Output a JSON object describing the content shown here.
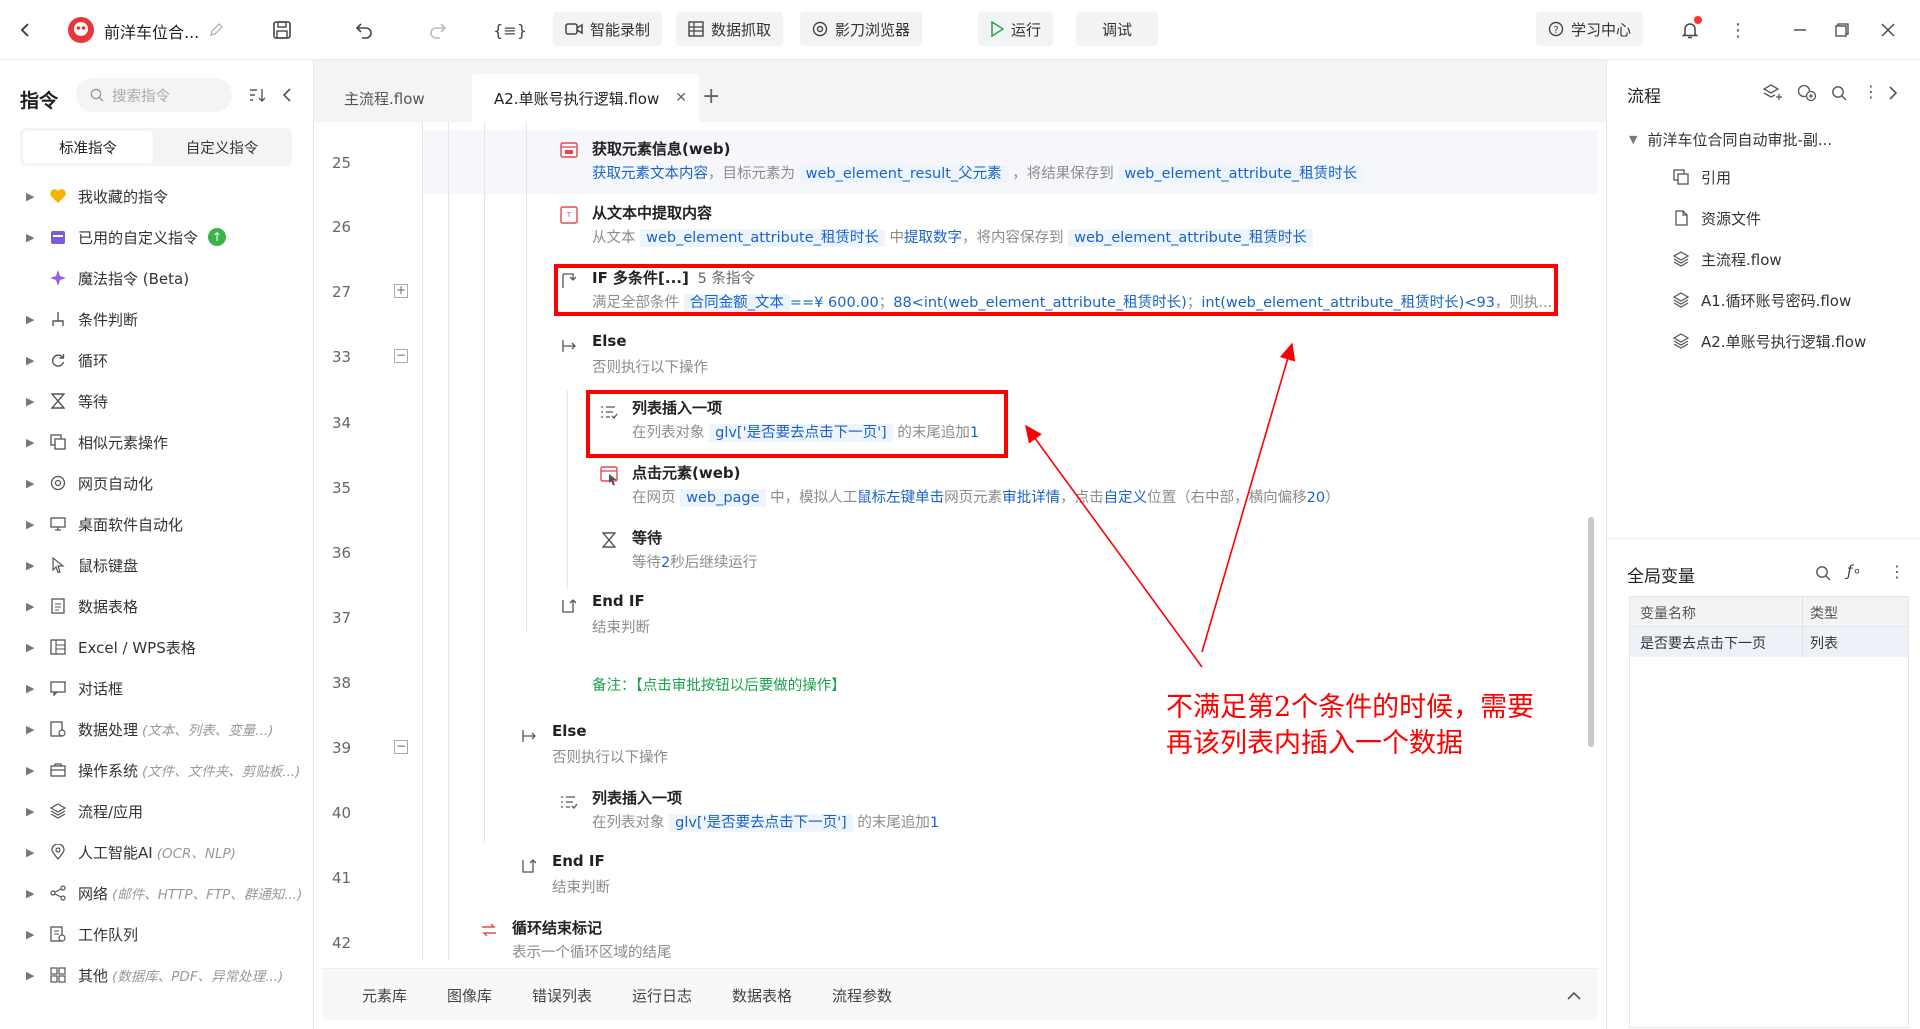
{
  "topbar": {
    "project_name": "前洋车位合...",
    "buttons": {
      "smart_record": "智能录制",
      "data_grab": "数据抓取",
      "browser": "影刀浏览器",
      "run": "运行",
      "debug": "调试",
      "learn": "学习中心"
    }
  },
  "left": {
    "title": "指令",
    "search_placeholder": "搜索指令",
    "tabs": {
      "standard": "标准指令",
      "custom": "自定义指令"
    },
    "items": [
      {
        "label": "我收藏的指令",
        "hint": ""
      },
      {
        "label": "已用的自定义指令",
        "hint": ""
      },
      {
        "label": "魔法指令 (Beta)",
        "hint": ""
      },
      {
        "label": "条件判断",
        "hint": ""
      },
      {
        "label": "循环",
        "hint": ""
      },
      {
        "label": "等待",
        "hint": ""
      },
      {
        "label": "相似元素操作",
        "hint": ""
      },
      {
        "label": "网页自动化",
        "hint": ""
      },
      {
        "label": "桌面软件自动化",
        "hint": ""
      },
      {
        "label": "鼠标键盘",
        "hint": ""
      },
      {
        "label": "数据表格",
        "hint": ""
      },
      {
        "label": "Excel / WPS表格",
        "hint": ""
      },
      {
        "label": "对话框",
        "hint": ""
      },
      {
        "label": "数据处理",
        "hint": "(文本、列表、变量...)"
      },
      {
        "label": "操作系统",
        "hint": "(文件、文件夹、剪贴板...)"
      },
      {
        "label": "流程/应用",
        "hint": ""
      },
      {
        "label": "人工智能AI",
        "hint": "(OCR、NLP)"
      },
      {
        "label": "网络",
        "hint": "(邮件、HTTP、FTP、群通知...)"
      },
      {
        "label": "工作队列",
        "hint": ""
      },
      {
        "label": "其他",
        "hint": "(数据库、PDF、异常处理...)"
      }
    ]
  },
  "tabs": [
    "主流程.flow",
    "A2.单账号执行逻辑.flow"
  ],
  "editor": {
    "rows": [
      {
        "num": "25",
        "title": "获取元素信息(web)",
        "desc": {
          "a": "获取元素文本内容",
          "b": "，目标元素为",
          "c": "web_element_result_父元素",
          "d": "，将结果保存到",
          "e": "web_element_attribute_租赁时长"
        }
      },
      {
        "num": "26",
        "title": "从文本中提取内容",
        "desc": {
          "a": "从文本",
          "b": "web_element_attribute_租赁时长",
          "c": "中",
          "d": "提取数字",
          "e": "，将内容保存到",
          "f": "web_element_attribute_租赁时长"
        }
      },
      {
        "num": "27",
        "title": "IF 多条件[...]",
        "count": "5 条指令",
        "desc": {
          "a": "满足全部条件",
          "b": "合同金额_文本",
          "c": "==¥ 600.00",
          "d": "；",
          "e": "88<int(web_element_attribute_租赁时长)",
          "f": "；",
          "g": "int(web_element_attribute_租赁时长)<93",
          "h": "，则执..."
        }
      },
      {
        "num": "33",
        "title": "Else",
        "desc": "否则执行以下操作"
      },
      {
        "num": "34",
        "title": "列表插入一项",
        "desc": {
          "a": "在列表对象",
          "b": "glv['是否要去点击下一页']",
          "c": "的末尾追加",
          "d": "1"
        }
      },
      {
        "num": "35",
        "title": "点击元素(web)",
        "desc": {
          "a": "在网页",
          "b": "web_page",
          "c": "中，模拟人工",
          "d": "鼠标左键单击",
          "e": "网页元素",
          "f": "审批详情",
          "g": "，点击",
          "h": "自定义",
          "i": "位置（右中部，横向偏移",
          "j": "20",
          "k": "）"
        }
      },
      {
        "num": "36",
        "title": "等待",
        "desc": {
          "a": "等待",
          "b": "2",
          "c": "秒后继续运行"
        }
      },
      {
        "num": "37",
        "title": "End IF",
        "desc": "结束判断"
      },
      {
        "num": "38",
        "note": "备注：【点击审批按钮以后要做的操作】"
      },
      {
        "num": "39",
        "title": "Else",
        "desc": "否则执行以下操作"
      },
      {
        "num": "40",
        "title": "列表插入一项",
        "desc": {
          "a": "在列表对象",
          "b": "glv['是否要去点击下一页']",
          "c": "的末尾追加",
          "d": "1"
        }
      },
      {
        "num": "41",
        "title": "End IF",
        "desc": "结束判断"
      },
      {
        "num": "42",
        "title": "循环结束标记",
        "desc": "表示一个循环区域的结尾"
      }
    ],
    "annotation": {
      "line1": "不满足第2个条件的时候，需要",
      "line2": "再该列表内插入一个数据"
    },
    "colors": {
      "annotation": "#ff0000",
      "highlight": "#1a63c9",
      "note": "#19a34a"
    }
  },
  "bottom_tabs": [
    "元素库",
    "图像库",
    "错误列表",
    "运行日志",
    "数据表格",
    "流程参数"
  ],
  "right": {
    "title": "流程",
    "tree_root": "前洋车位合同自动审批-副...",
    "items": [
      "引用",
      "资源文件",
      "主流程.flow",
      "A1.循环账号密码.flow",
      "A2.单账号执行逻辑.flow"
    ],
    "vars": {
      "title": "全局变量",
      "headers": [
        "变量名称",
        "类型"
      ],
      "rows": [
        [
          "是否要去点击下一页",
          "列表"
        ]
      ]
    }
  }
}
